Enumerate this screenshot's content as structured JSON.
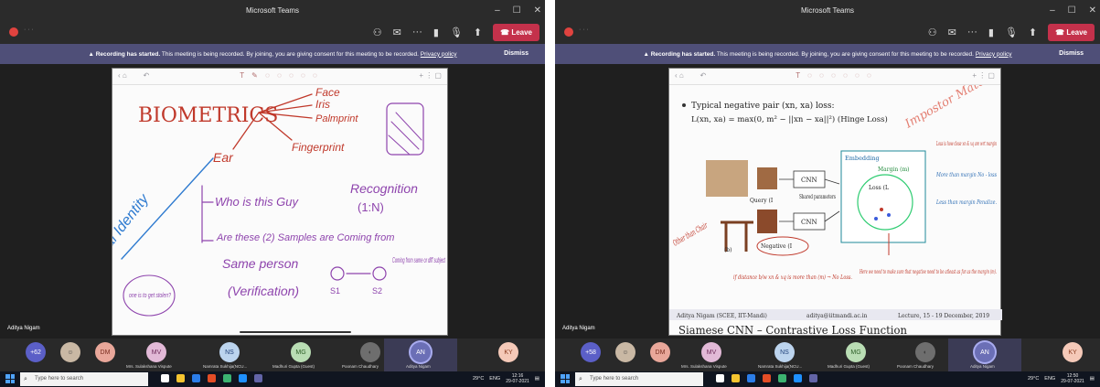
{
  "app_title": "Microsoft Teams",
  "window_controls": {
    "minimize": "–",
    "maximize": "☐",
    "close": "✕"
  },
  "toolbar": {
    "leave_label": "Leave"
  },
  "banner": {
    "title": "Recording has started.",
    "text": "This meeting is being recorded. By joining, you are giving consent for this meeting to be recorded.",
    "link": "Privacy policy",
    "dismiss": "Dismiss"
  },
  "presenter_name": "Aditya Nigam",
  "left_slide": {
    "title": "BIOMETRICS",
    "items": [
      "Face",
      "Iris",
      "Palmprint",
      "Fingerprint",
      "Ear"
    ],
    "side_text": "Digital Identity",
    "q1": "Who is this Guy",
    "q1_answer": "Recognition",
    "q1_ratio": "(1:N)",
    "q2": "Are these (2) Samples are Coming from",
    "q2_cont": "Same person",
    "q2_verif": "(Verification)",
    "s1": "S1",
    "s2": "S2",
    "coming_note": "Coming from same or diff subject",
    "circle_note": "one is to get stolen?"
  },
  "right_slide": {
    "bullet_heading": "Typical negative pair (xn, xa) loss:",
    "formula": "L(xn, xa) = max(0, m² − ||xn − xa||²) (Hinge Loss)",
    "cnn": "CNN",
    "query": "Query (I",
    "shared": "Shared parameters",
    "negative": "Negative (I",
    "embedding": "Embedding",
    "margin": "Margin (m)",
    "loss": "Loss (L",
    "b_label": "(b)",
    "footer_left": "Aditya Nigam (SCEE, IIT-Mandi)",
    "footer_email": "aditya@iitmandi.ac.in",
    "footer_right": "Lecture, 15 - 19 December, 2019",
    "next_slide_title": "Siamese CNN – Contrastive Loss Function",
    "anno_impostor": "Impostor Match",
    "anno_other_chair": "Other than Chair",
    "anno_distance": "if distance b/w xn & xq is more than (m) → No Loss.",
    "anno_here": "Here we need to make sure that negative need to be atleast as far as the margin (m).",
    "anno_loss": "Loss is how close xn & xq are wrt margin",
    "anno_more": "More than margin No - loss",
    "anno_less": "Less than margin Penalize."
  },
  "left_participants": {
    "count": "+62",
    "items": [
      {
        "initials": "DM",
        "name": ""
      },
      {
        "initials": "MV",
        "name": "Mrs. Sulakshana Vispute"
      },
      {
        "initials": "NS",
        "name": "Namrata Sukhija(NCU..."
      },
      {
        "initials": "MG",
        "name": "Madhuri Gupta (Guest)"
      },
      {
        "initials": "",
        "name": "Poonam Chaudhary"
      },
      {
        "initials": "AN",
        "name": "Aditya Nigam"
      },
      {
        "initials": "KY",
        "name": ""
      }
    ]
  },
  "right_participants": {
    "count": "+58"
  },
  "taskbar": {
    "search_placeholder": "Type here to search",
    "temp": "29°C",
    "lang": "ENG",
    "left_time": "12:16",
    "right_time": "12:50",
    "date": "29-07-2021"
  }
}
